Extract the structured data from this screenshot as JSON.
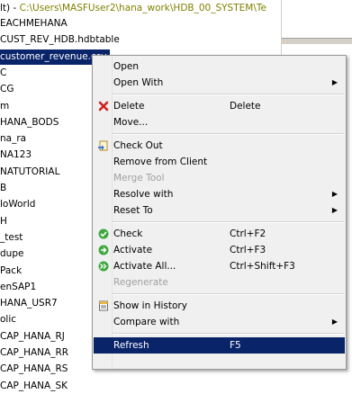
{
  "path_bar": {
    "prefix": "lt) - ",
    "value": "C:\\Users\\MASFUser2\\hana_work\\HDB_00_SYSTEM\\Te"
  },
  "tree": [
    {
      "label": "EACHMEHANA",
      "selected": false
    },
    {
      "label": "CUST_REV_HDB.hdbtable",
      "selected": false
    },
    {
      "label": "customer_revenue.csv",
      "selected": true
    },
    {
      "label": "C",
      "selected": false
    },
    {
      "label": "CG",
      "selected": false
    },
    {
      "label": "m",
      "selected": false
    },
    {
      "label": "HANA_BODS",
      "selected": false
    },
    {
      "label": "na_ra",
      "selected": false
    },
    {
      "label": "NA123",
      "selected": false
    },
    {
      "label": "NATUTORIAL",
      "selected": false
    },
    {
      "label": "B",
      "selected": false
    },
    {
      "label": "loWorld",
      "selected": false
    },
    {
      "label": "H",
      "selected": false
    },
    {
      "label": "_test",
      "selected": false
    },
    {
      "label": "dupe",
      "selected": false
    },
    {
      "label": "Pack",
      "selected": false
    },
    {
      "label": "enSAP1",
      "selected": false
    },
    {
      "label": "HANA_USR7",
      "selected": false
    },
    {
      "label": "olic",
      "selected": false
    },
    {
      "label": "CAP_HANA_RJ",
      "selected": false
    },
    {
      "label": "CAP_HANA_RR",
      "selected": false
    },
    {
      "label": "CAP_HANA_RS",
      "selected": false
    },
    {
      "label": "CAP_HANA_SK",
      "selected": false
    }
  ],
  "right_pane": {
    "text1": "",
    "text2": "le"
  },
  "menu": {
    "items": [
      {
        "label": "Open",
        "shortcut": "",
        "submenu": false,
        "disabled": false,
        "icon": ""
      },
      {
        "label": "Open With",
        "shortcut": "",
        "submenu": true,
        "disabled": false,
        "icon": ""
      },
      {
        "sep": true
      },
      {
        "label": "Delete",
        "shortcut": "Delete",
        "submenu": false,
        "disabled": false,
        "icon": "delete-icon"
      },
      {
        "label": "Move...",
        "shortcut": "",
        "submenu": false,
        "disabled": false,
        "icon": ""
      },
      {
        "sep": true
      },
      {
        "label": "Check Out",
        "shortcut": "",
        "submenu": false,
        "disabled": false,
        "icon": "checkout-icon"
      },
      {
        "label": "Remove from Client",
        "shortcut": "",
        "submenu": false,
        "disabled": false,
        "icon": ""
      },
      {
        "label": "Merge Tool",
        "shortcut": "",
        "submenu": false,
        "disabled": true,
        "icon": ""
      },
      {
        "label": "Resolve with",
        "shortcut": "",
        "submenu": true,
        "disabled": false,
        "icon": ""
      },
      {
        "label": "Reset To",
        "shortcut": "",
        "submenu": true,
        "disabled": false,
        "icon": ""
      },
      {
        "sep": true
      },
      {
        "label": "Check",
        "shortcut": "Ctrl+F2",
        "submenu": false,
        "disabled": false,
        "icon": "check-icon"
      },
      {
        "label": "Activate",
        "shortcut": "Ctrl+F3",
        "submenu": false,
        "disabled": false,
        "icon": "activate-icon"
      },
      {
        "label": "Activate All...",
        "shortcut": "Ctrl+Shift+F3",
        "submenu": false,
        "disabled": false,
        "icon": "activate-all-icon"
      },
      {
        "label": "Regenerate",
        "shortcut": "",
        "submenu": false,
        "disabled": true,
        "icon": ""
      },
      {
        "sep": true
      },
      {
        "label": "Show in History",
        "shortcut": "",
        "submenu": false,
        "disabled": false,
        "icon": "history-icon"
      },
      {
        "label": "Compare with",
        "shortcut": "",
        "submenu": true,
        "disabled": false,
        "icon": ""
      },
      {
        "sep": true
      },
      {
        "label": "Refresh",
        "shortcut": "F5",
        "submenu": false,
        "disabled": false,
        "icon": "refresh-icon",
        "highlighted": true
      }
    ]
  },
  "colors": {
    "selection": "#0a246a",
    "path_value": "#808000",
    "menu_bg": "#f0f0f0"
  }
}
